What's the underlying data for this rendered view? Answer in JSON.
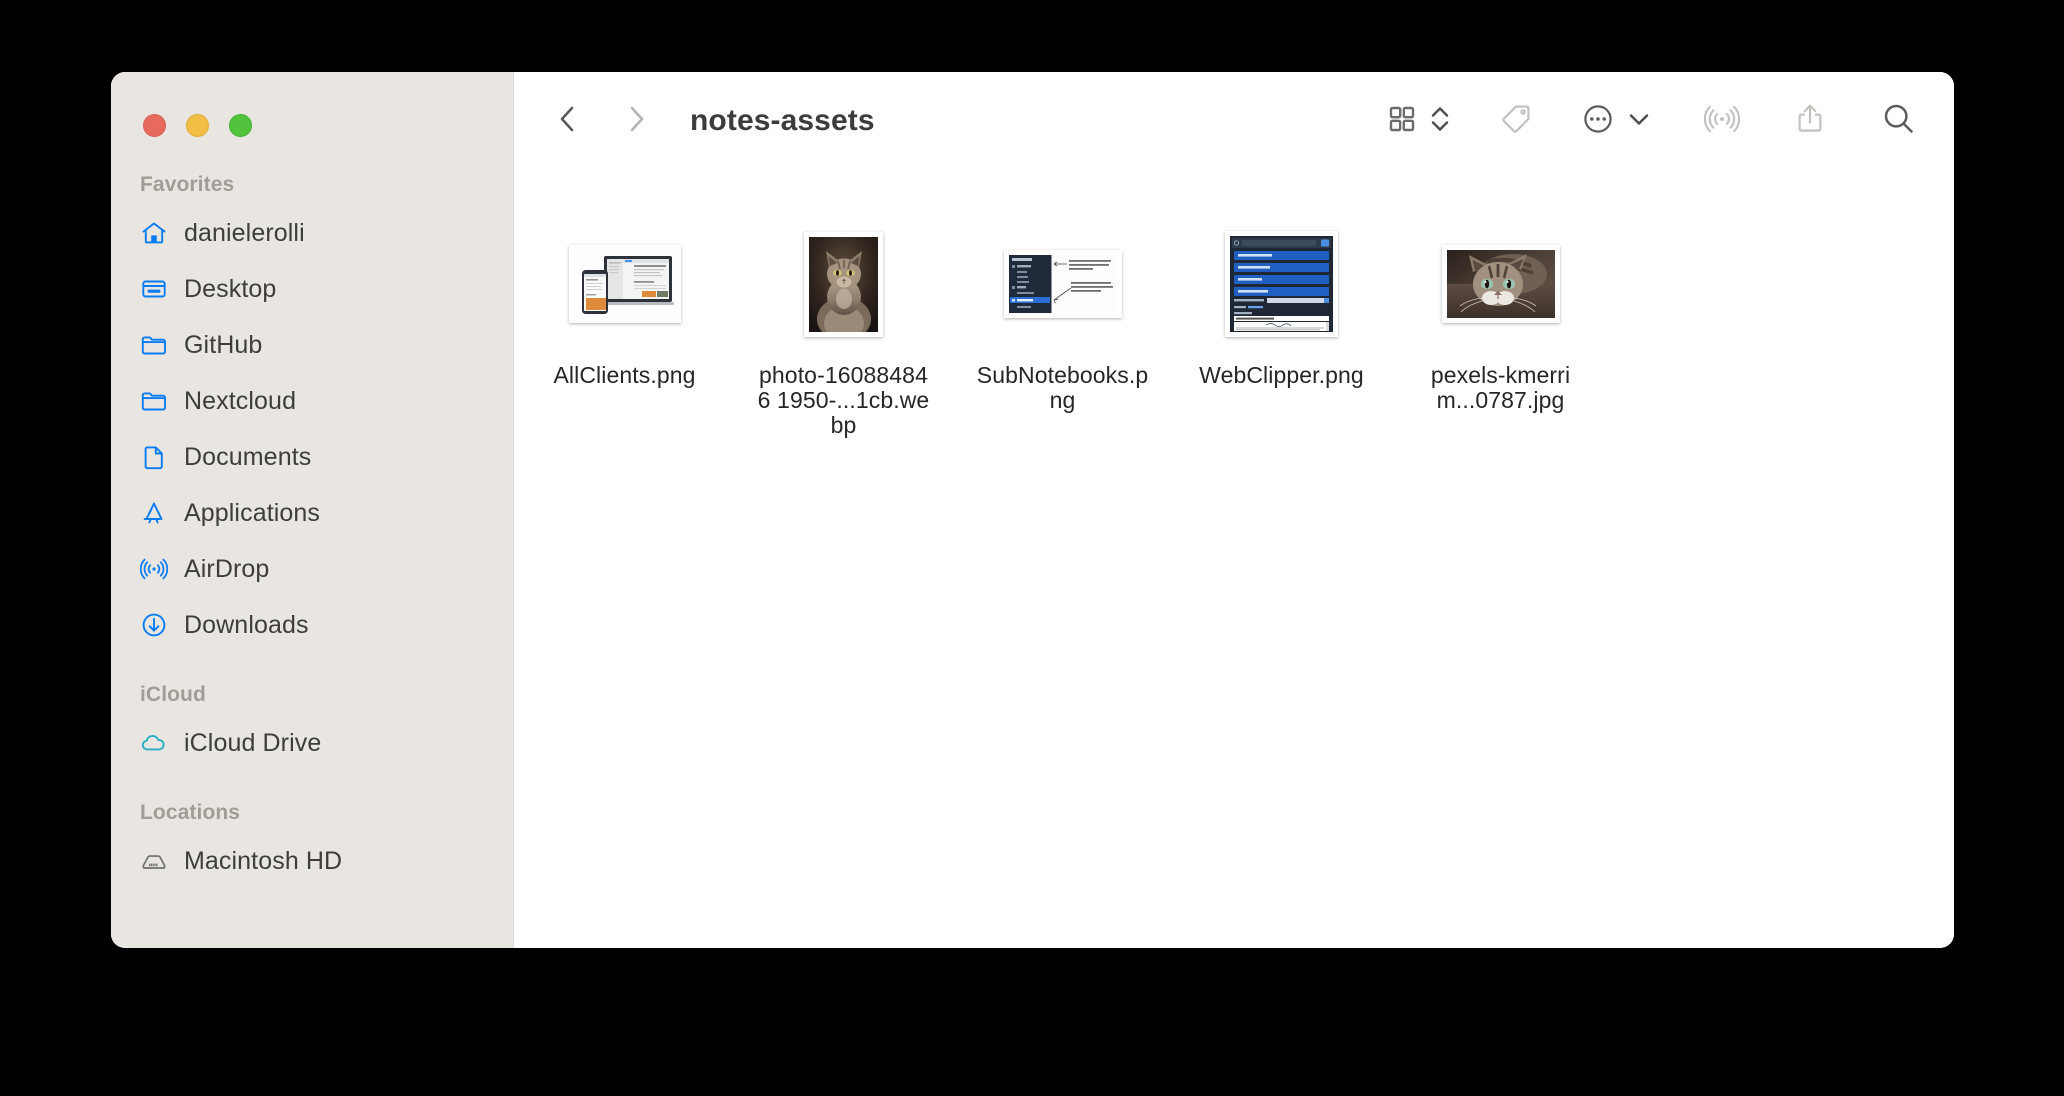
{
  "window": {
    "title": "notes-assets",
    "traffic_lights": [
      {
        "name": "close",
        "color": "#e8695e"
      },
      {
        "name": "minimize",
        "color": "#f2be45"
      },
      {
        "name": "maximize",
        "color": "#52c33d"
      }
    ]
  },
  "toolbar": {
    "back_icon": "chevron-left-icon",
    "forward_icon": "chevron-right-icon",
    "title": "notes-assets",
    "view_icon": "grid-view-icon",
    "view_chevrons_icon": "chevron-up-down-icon",
    "tag_icon": "tag-icon",
    "more_icon": "ellipsis-circle-icon",
    "more_chevron_icon": "chevron-down-icon",
    "airdrop_icon": "airdrop-icon",
    "share_icon": "share-icon",
    "search_icon": "search-icon"
  },
  "sidebar": {
    "sections": [
      {
        "header": "Favorites",
        "items": [
          {
            "label": "danielerolli",
            "icon": "home-icon",
            "color": "#0a7cf3"
          },
          {
            "label": "Desktop",
            "icon": "desktop-icon",
            "color": "#0a7cf3"
          },
          {
            "label": "GitHub",
            "icon": "folder-icon",
            "color": "#0a7cf3"
          },
          {
            "label": "Nextcloud",
            "icon": "folder-icon",
            "color": "#0a7cf3"
          },
          {
            "label": "Documents",
            "icon": "document-icon",
            "color": "#0a7cf3"
          },
          {
            "label": "Applications",
            "icon": "applications-icon",
            "color": "#0a7cf3"
          },
          {
            "label": "AirDrop",
            "icon": "airdrop-icon",
            "color": "#0a7cf3"
          },
          {
            "label": "Downloads",
            "icon": "downloads-icon",
            "color": "#0a7cf3"
          }
        ]
      },
      {
        "header": "iCloud",
        "items": [
          {
            "label": "iCloud Drive",
            "icon": "cloud-icon",
            "color": "#2aaec4"
          }
        ]
      },
      {
        "header": "Locations",
        "items": [
          {
            "label": "Macintosh HD",
            "icon": "harddisk-icon",
            "color": "#6e6e6e"
          }
        ]
      }
    ]
  },
  "files": [
    {
      "name": "AllClients.png",
      "thumb": "devices-mockup",
      "kind": "png"
    },
    {
      "name": "photo-160884846 1950-...1cb.webp",
      "thumb": "cat-portrait",
      "kind": "webp"
    },
    {
      "name": "SubNotebooks.png",
      "thumb": "notebooks-ui",
      "kind": "png"
    },
    {
      "name": "WebClipper.png",
      "thumb": "webclipper-ui",
      "kind": "png"
    },
    {
      "name": "pexels-kmerrim...0787.jpg",
      "thumb": "cat-landscape",
      "kind": "jpg"
    }
  ],
  "colors": {
    "sidebar_bg": "#e9e6e1",
    "content_bg": "#ffffff",
    "accent_blue": "#0a7cf3",
    "desktop_bg": "#000000",
    "header_text": "#a09c96",
    "label_text": "#3d3d3d"
  }
}
